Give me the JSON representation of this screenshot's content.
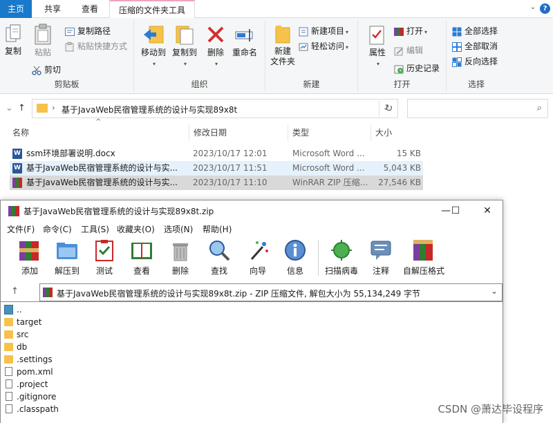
{
  "explorer": {
    "tabs": {
      "file": "主页",
      "share": "共享",
      "view": "查看",
      "contextual": "压缩的文件夹工具"
    },
    "ribbon": {
      "clipboard": {
        "label": "剪贴板",
        "copy": "复制",
        "paste": "粘贴",
        "copy_path": "复制路径",
        "paste_shortcut": "粘贴快捷方式",
        "cut": "剪切"
      },
      "organize": {
        "label": "组织",
        "move_to": "移动到",
        "copy_to": "复制到",
        "delete": "删除",
        "rename": "重命名"
      },
      "new": {
        "label": "新建",
        "new_folder_line1": "新建",
        "new_folder_line2": "文件夹",
        "new_item": "新建项目",
        "easy_access": "轻松访问"
      },
      "open": {
        "label": "打开",
        "properties": "属性",
        "open": "打开",
        "edit": "编辑",
        "history": "历史记录"
      },
      "select": {
        "label": "选择",
        "select_all": "全部选择",
        "select_none": "全部取消",
        "invert": "反向选择"
      }
    },
    "address": {
      "path": "基于JavaWeb民宿管理系统的设计与实现89x8t",
      "search_placeholder": ""
    },
    "columns": [
      "名称",
      "修改日期",
      "类型",
      "大小"
    ],
    "files": [
      {
        "name": "ssm环境部署说明.docx",
        "date": "2023/10/17 12:01",
        "type": "Microsoft Word ...",
        "size": "15 KB",
        "icon": "word-icon"
      },
      {
        "name": "基于JavaWeb民宿管理系统的设计与实...",
        "date": "2023/10/17 11:51",
        "type": "Microsoft Word ...",
        "size": "5,043 KB",
        "icon": "word-icon"
      },
      {
        "name": "基于JavaWeb民宿管理系统的设计与实...",
        "date": "2023/10/17 11:10",
        "type": "WinRAR ZIP 压缩...",
        "size": "27,546 KB",
        "icon": "winrar-icon"
      }
    ]
  },
  "winrar": {
    "title": "基于JavaWeb民宿管理系统的设计与实现89x8t.zip",
    "menu": [
      "文件(F)",
      "命令(C)",
      "工具(S)",
      "收藏夹(O)",
      "选项(N)",
      "帮助(H)"
    ],
    "toolbar": [
      "添加",
      "解压到",
      "测试",
      "查看",
      "删除",
      "查找",
      "向导",
      "信息",
      "扫描病毒",
      "注释",
      "自解压格式"
    ],
    "path": "基于JavaWeb民宿管理系统的设计与实现89x8t.zip - ZIP 压缩文件, 解包大小为 55,134,249 字节",
    "items": [
      {
        "name": "..",
        "kind": "up"
      },
      {
        "name": "target",
        "kind": "folder"
      },
      {
        "name": "src",
        "kind": "folder"
      },
      {
        "name": "db",
        "kind": "folder"
      },
      {
        "name": ".settings",
        "kind": "folder"
      },
      {
        "name": "pom.xml",
        "kind": "xml"
      },
      {
        "name": ".project",
        "kind": "file"
      },
      {
        "name": ".gitignore",
        "kind": "file"
      },
      {
        "name": ".classpath",
        "kind": "file"
      }
    ]
  },
  "watermark": "CSDN @萧达毕设程序"
}
